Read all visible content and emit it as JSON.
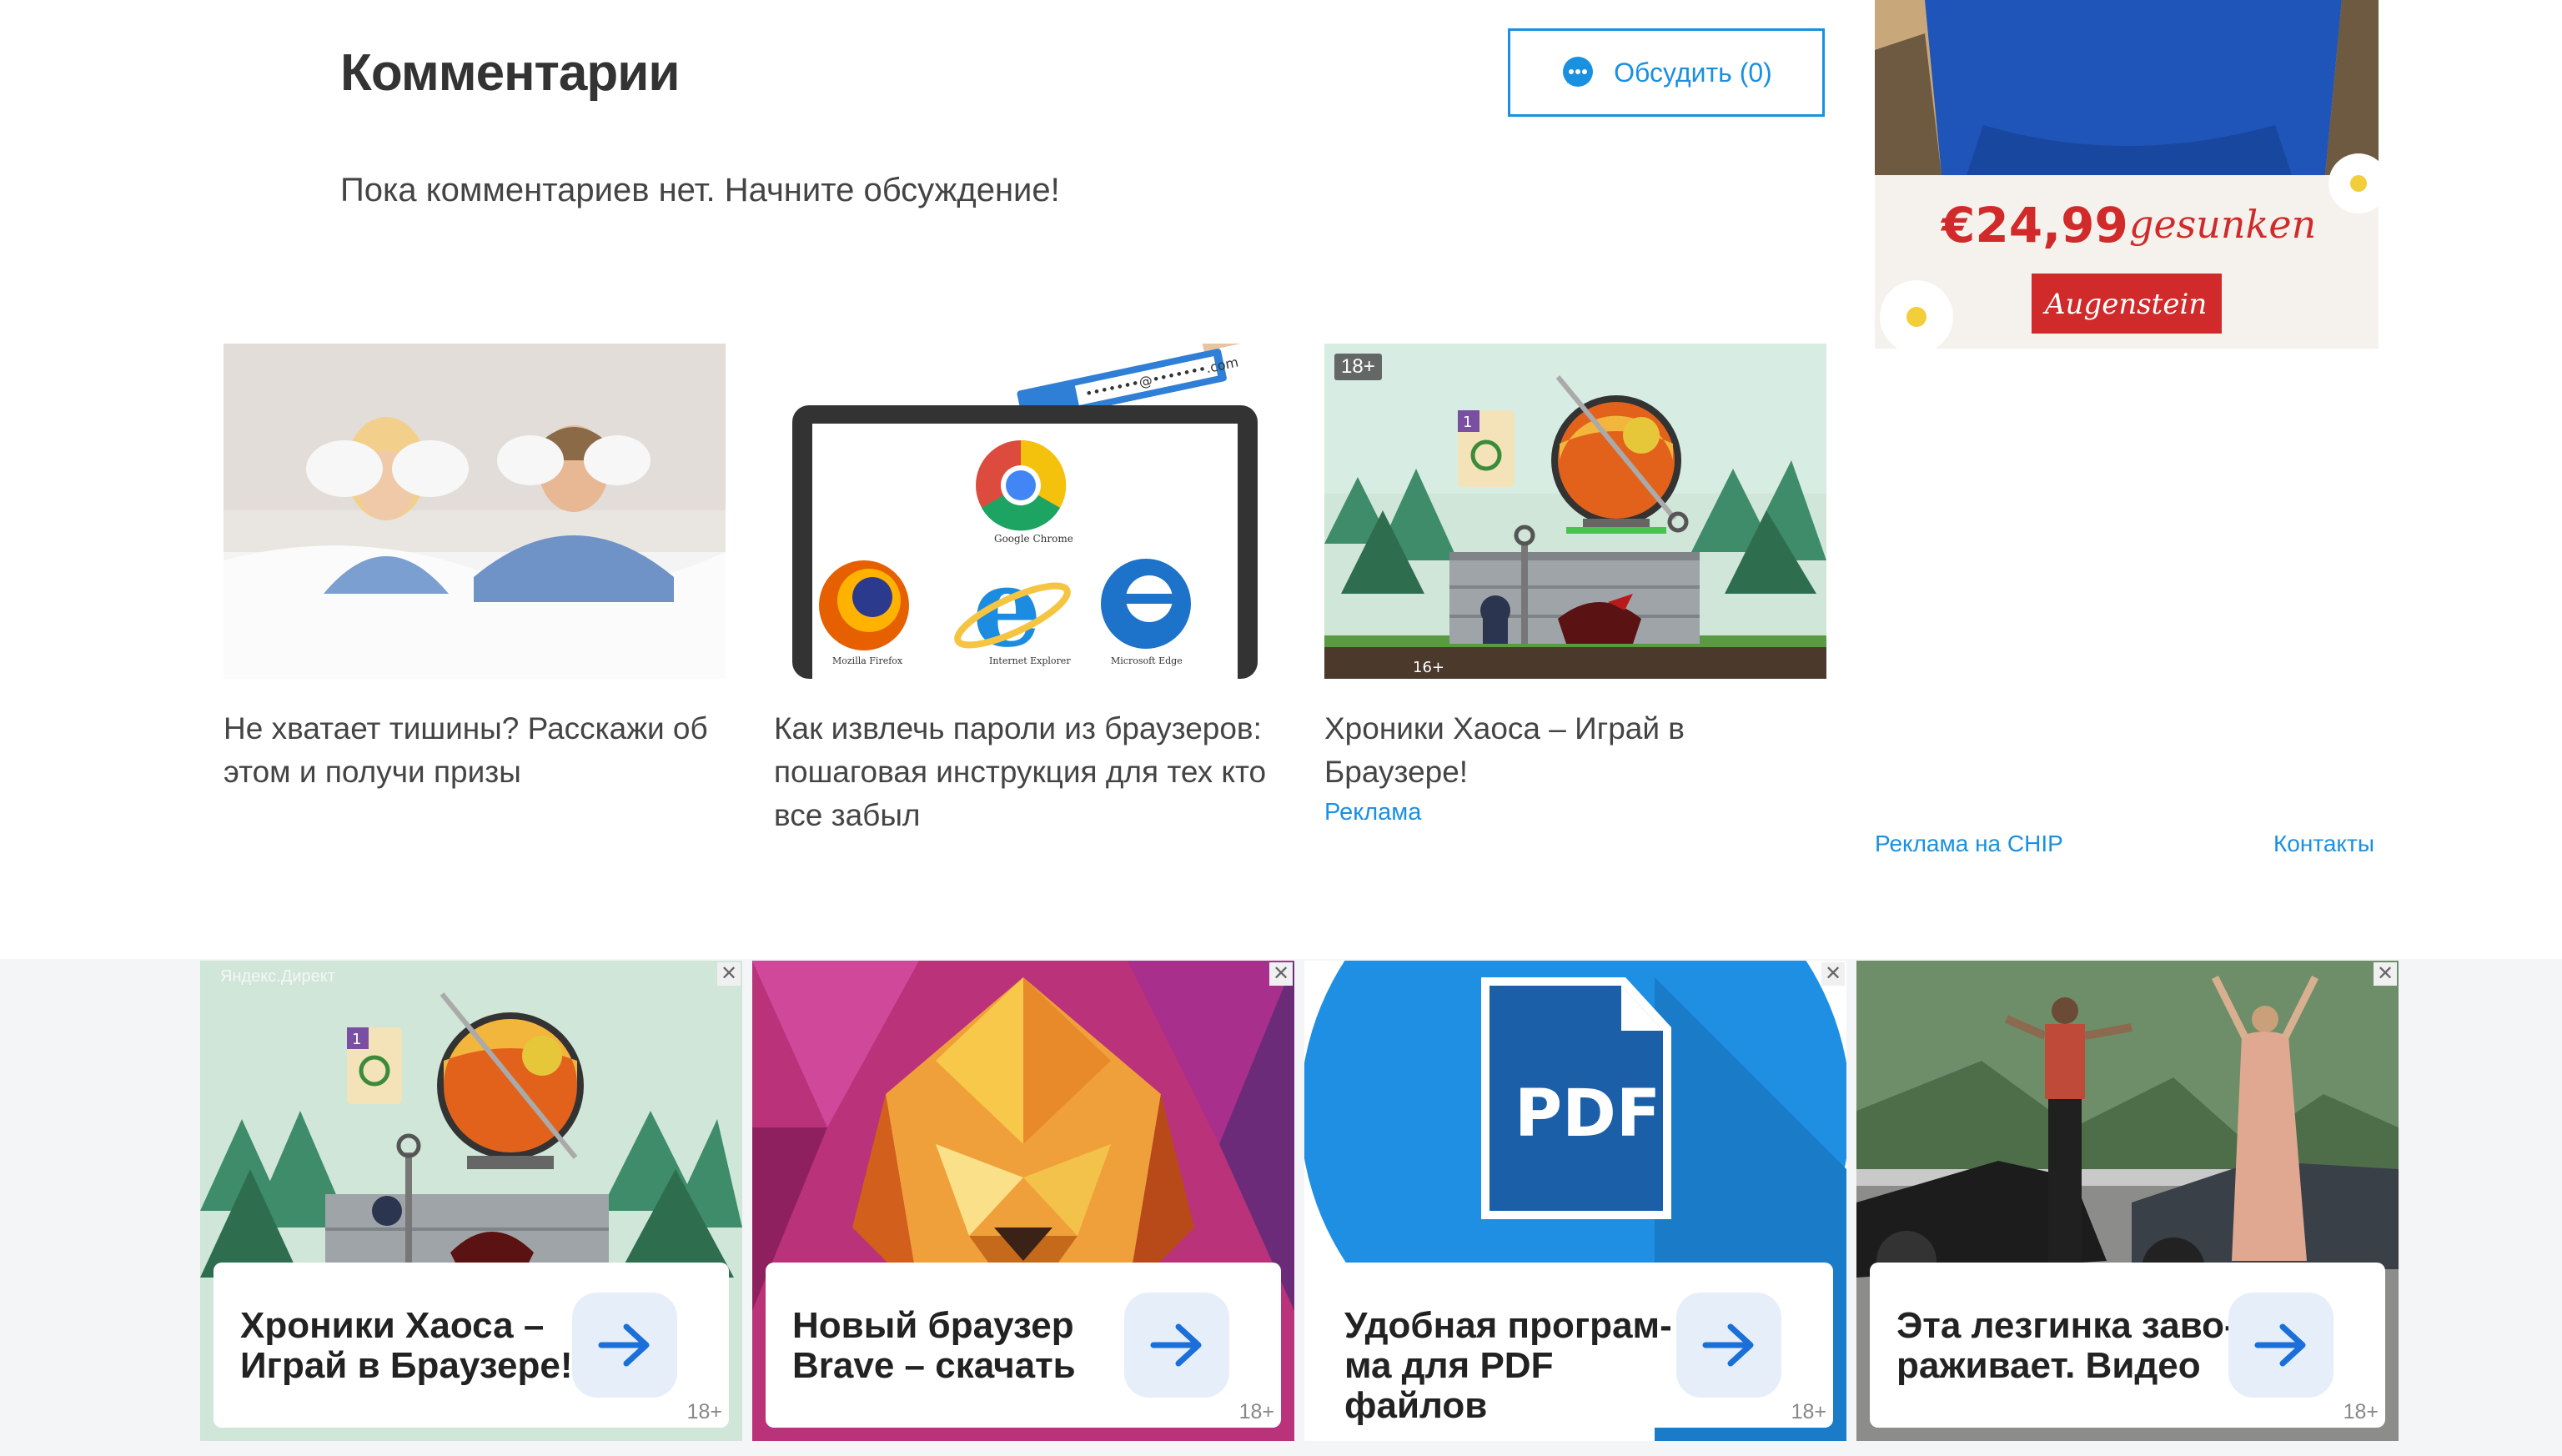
{
  "comments": {
    "title": "Комментарии",
    "discuss_label": "Обсудить (0)",
    "empty_text": "Пока комментариев нет. Начните обсуждение!"
  },
  "cards": [
    {
      "title": "Не хватает тишины? Расскажи об этом и получи призы"
    },
    {
      "title": "Как извлечь пароли из браузеров: пошаговая инструкция для тех кто все забыл",
      "browser_labels": [
        "Google Chrome",
        "Mozilla Firefox",
        "Internet Explorer",
        "Microsoft Edge"
      ],
      "email_text": "•••••••@•••••••.com"
    },
    {
      "title": "Хроники Хаоса – Играй в Браузере!",
      "ad_label": "Реклама",
      "age": "18+",
      "inner_age": "16+",
      "card_number": "1"
    }
  ],
  "sidebar": {
    "price": "€24,99",
    "price_word": "gesunken",
    "brand": "Augenstein",
    "ads_link": "Реклама на CHIP",
    "contacts_link": "Контакты"
  },
  "bottom_ads": {
    "source_label": "Яндекс.Директ",
    "close_symbol": "✕",
    "items": [
      {
        "title": "Хроники Хаоса – Играй в Браузере!",
        "age": "18+",
        "card_number": "1"
      },
      {
        "title": "Новый браузер Brave – скачать",
        "age": "18+"
      },
      {
        "title": "Удобная програм-ма для PDF файлов",
        "age": "18+",
        "pdf_text": "PDF"
      },
      {
        "title": "Эта лезгинка заво-раживает. Видео",
        "age": "18+"
      }
    ]
  },
  "colors": {
    "accent": "#1a90e0",
    "text": "#333333",
    "arrow": "#1a6fd8"
  },
  "icons": [
    "chat-icon",
    "arrow-right-icon",
    "close-icon"
  ]
}
